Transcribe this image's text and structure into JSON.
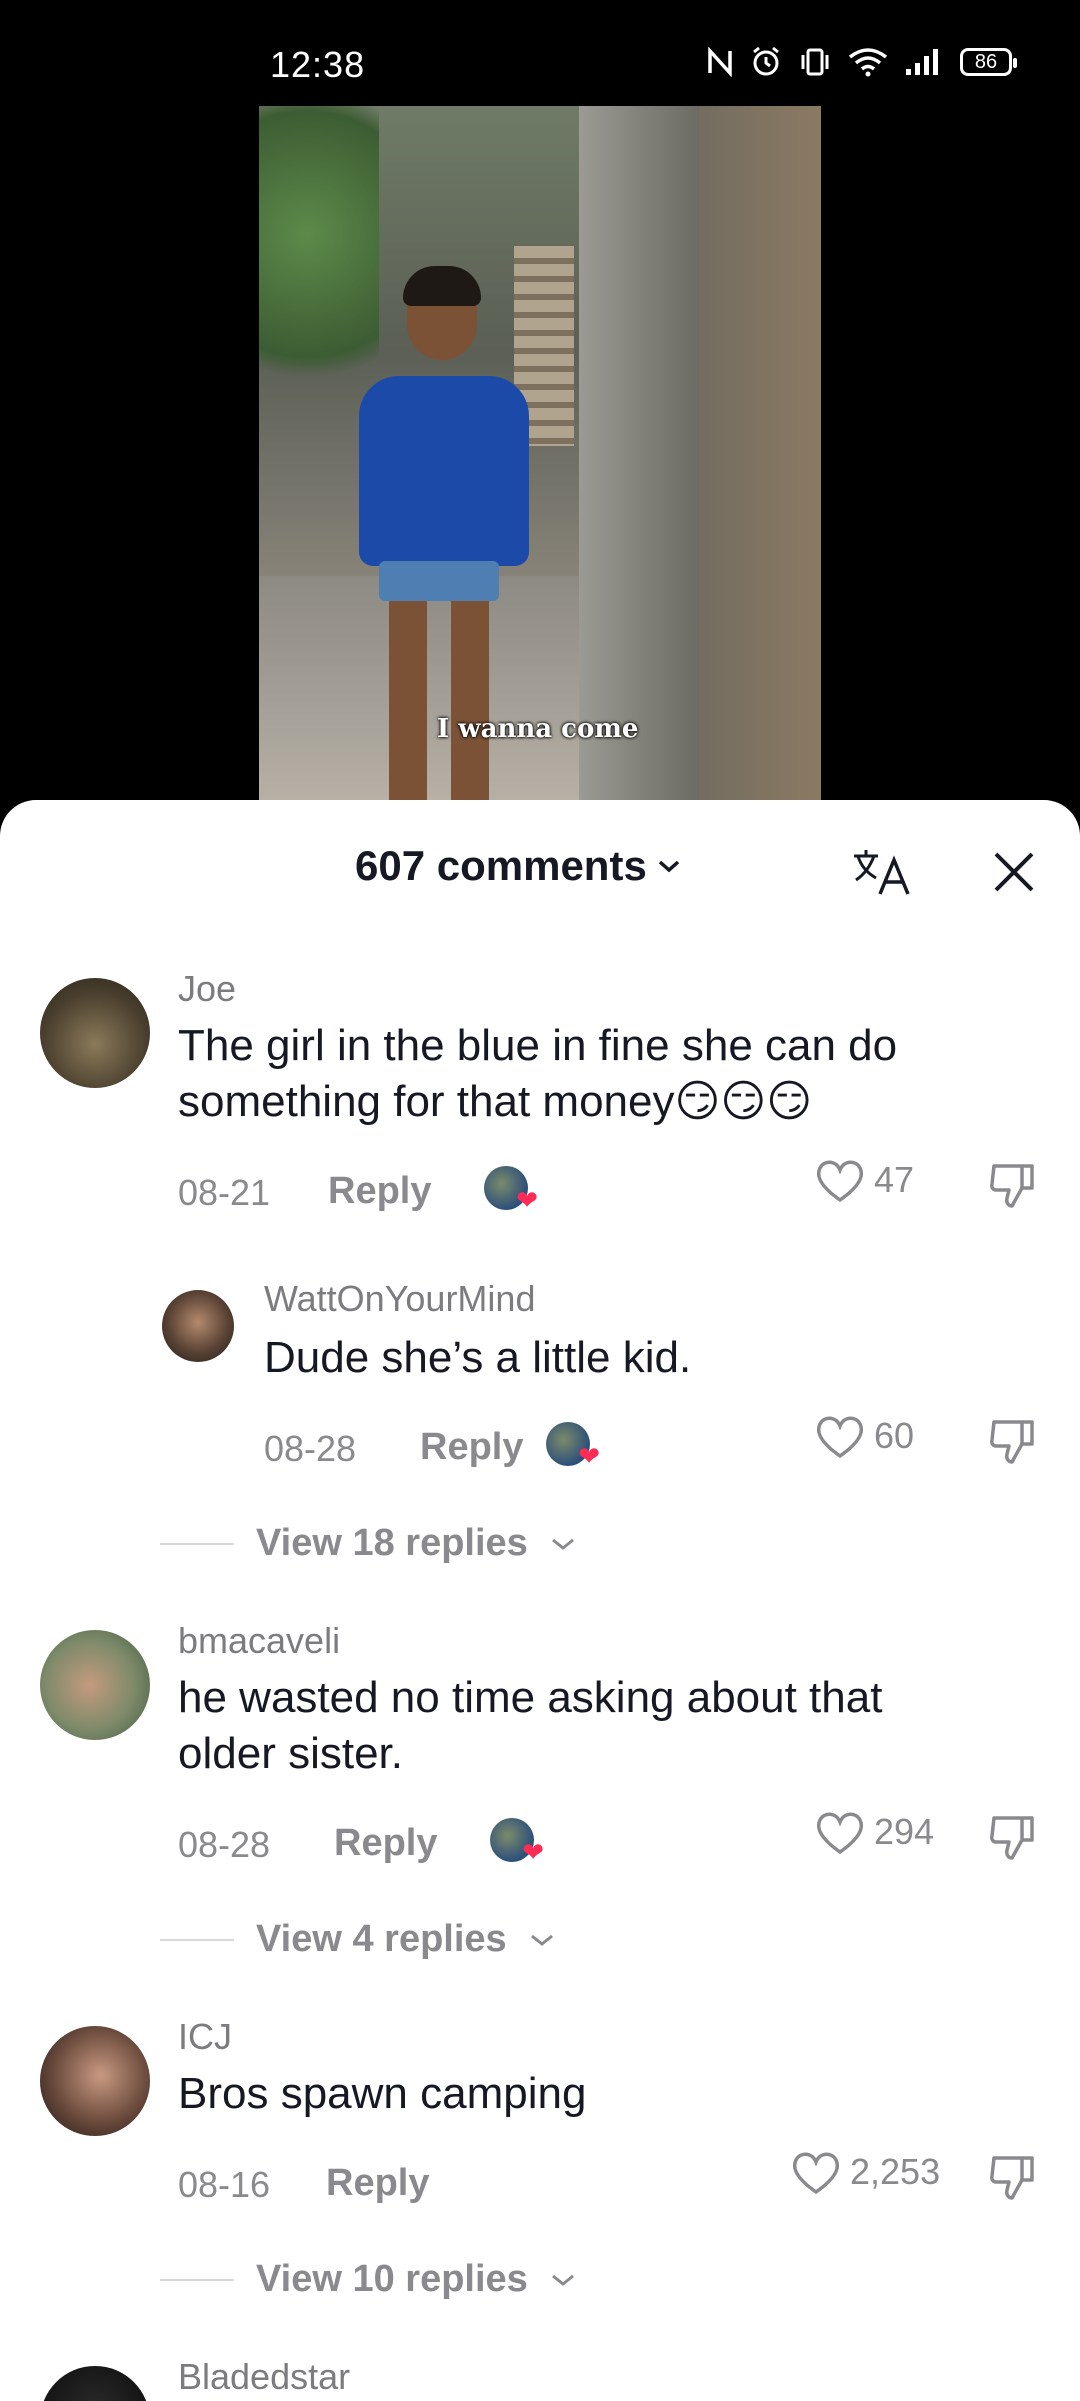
{
  "status_bar": {
    "time": "12:38",
    "battery": "86",
    "icons": [
      "nfc-icon",
      "alarm-icon",
      "vibrate-icon",
      "wifi-icon",
      "signal-icon"
    ]
  },
  "video": {
    "caption": "I wanna come"
  },
  "comments_sheet": {
    "count_label": "607 comments",
    "translate_icon": "translate-icon",
    "close_icon": "close-icon"
  },
  "comments": [
    {
      "username": "Joe",
      "text": "The girl in the blue in fine she can do something for that money😏😏😏",
      "date": "08-21",
      "reply_label": "Reply",
      "likes": "47"
    },
    {
      "username": "WattOnYourMind",
      "text": "Dude she’s a little kid.",
      "date": "08-28",
      "reply_label": "Reply",
      "likes": "60"
    },
    {
      "username": "bmacaveli",
      "text": "he wasted no time asking about that older sister.",
      "date": "08-28",
      "reply_label": "Reply",
      "likes": "294"
    },
    {
      "username": "ICJ",
      "text": "Bros spawn camping",
      "date": "08-16",
      "reply_label": "Reply",
      "likes": "2,253"
    },
    {
      "username": "Bladedstar"
    }
  ],
  "view_replies": [
    {
      "label": "View 18 replies"
    },
    {
      "label": "View 4 replies"
    },
    {
      "label": "View 10 replies"
    }
  ],
  "colors": {
    "primary_text": "#161823",
    "secondary_text": "#8a8a8e",
    "like_heart": "#fe2c55"
  }
}
